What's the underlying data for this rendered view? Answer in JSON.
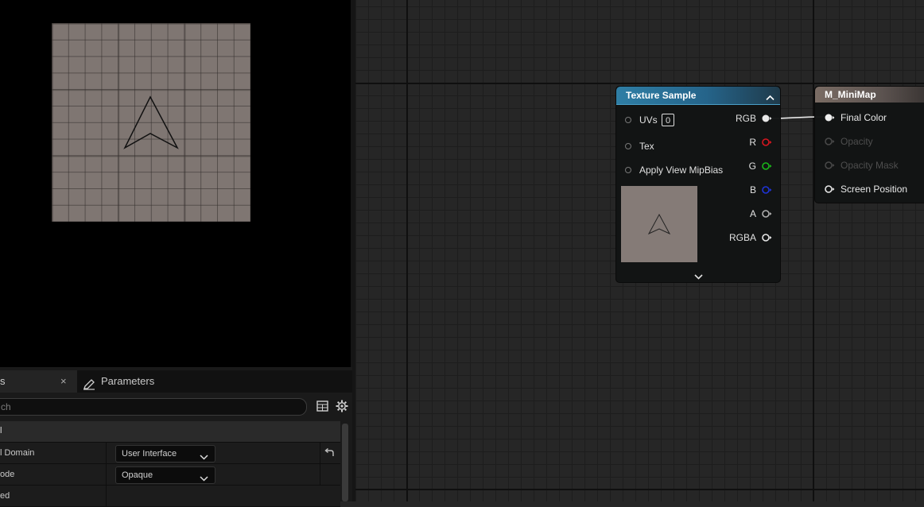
{
  "details_panel": {
    "tabs": [
      {
        "label": "s",
        "close": "×"
      },
      {
        "label": "Parameters"
      }
    ],
    "search": {
      "placeholder": "ch"
    },
    "category": "l",
    "properties": [
      {
        "name": "l Domain",
        "value": "User Interface"
      },
      {
        "name": "ode",
        "value": "Opaque"
      },
      {
        "name": "ed",
        "value": ""
      }
    ]
  },
  "nodes": {
    "texture_sample": {
      "title": "Texture Sample",
      "inputs": [
        {
          "label": "UVs",
          "value": "0"
        },
        {
          "label": "Tex"
        },
        {
          "label": "Apply View MipBias"
        }
      ],
      "outputs": [
        {
          "label": "RGB",
          "color": "#e8e8e8"
        },
        {
          "label": "R",
          "color": "#d8161f"
        },
        {
          "label": "G",
          "color": "#1ab81a"
        },
        {
          "label": "B",
          "color": "#1f34d9"
        },
        {
          "label": "A",
          "color": "#b0b0b0"
        },
        {
          "label": "RGBA",
          "color": "#e8e8e8"
        }
      ]
    },
    "material": {
      "title": "M_MiniMap",
      "inputs": [
        {
          "label": "Final Color",
          "enabled": true
        },
        {
          "label": "Opacity",
          "enabled": false
        },
        {
          "label": "Opacity Mask",
          "enabled": false
        },
        {
          "label": "Screen Position",
          "enabled": true
        }
      ]
    }
  },
  "colors": {
    "graph_background": "#262626",
    "texture_header": "#2f7ea5",
    "material_header": "#7a6c64"
  }
}
